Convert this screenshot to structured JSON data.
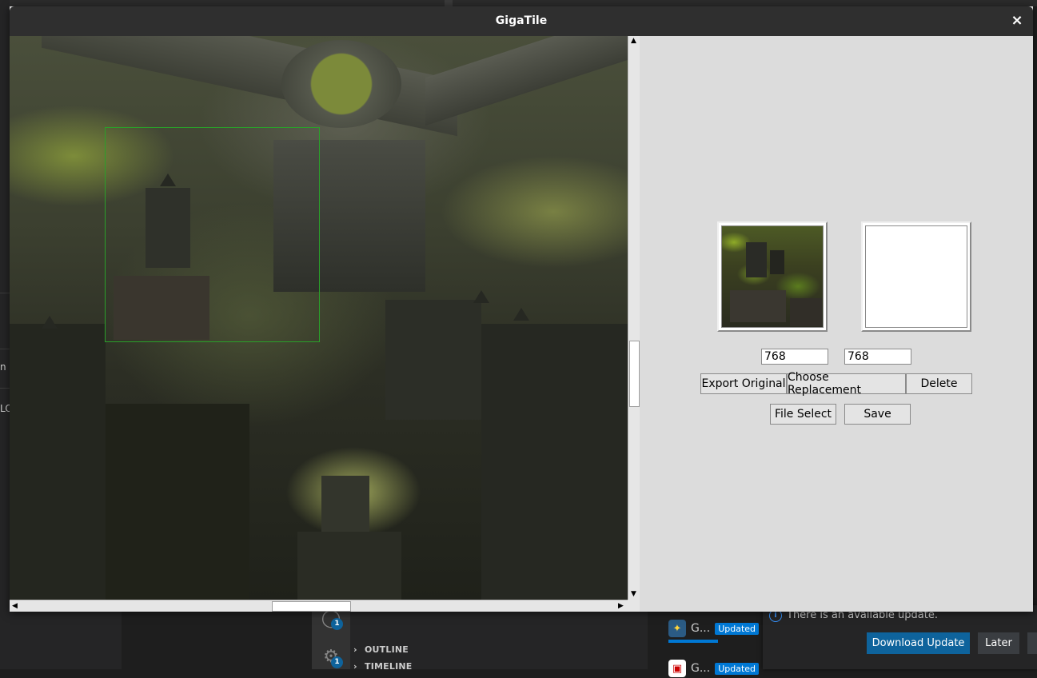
{
  "window": {
    "title": "GigaTile",
    "close_glyph": "×"
  },
  "panel": {
    "width_value": "768",
    "height_value": "768",
    "buttons": {
      "export_original": "Export Original",
      "choose_replacement": "Choose Replacement",
      "delete": "Delete",
      "file_select": "File Select",
      "save": "Save"
    }
  },
  "scrollbars": {
    "up_arrow": "▲",
    "down_arrow": "▼",
    "left_arrow": "◀",
    "right_arrow": "▶"
  },
  "background": {
    "left_fragments": [
      "n s",
      "LO"
    ],
    "sections": {
      "outline": "OUTLINE",
      "timeline": "TIMELINE",
      "chevron": "›"
    },
    "activity_badges": [
      "1",
      "1"
    ],
    "extensions": [
      {
        "icon": "python-icon",
        "name": "G...",
        "badge": "Updated"
      },
      {
        "icon": "extension-icon",
        "name": "G...",
        "badge": "Updated"
      }
    ],
    "notification": {
      "info_glyph": "i",
      "text": "There is an available update.",
      "download_label": "Download Update",
      "later_label": "Later"
    },
    "colors": {
      "accent": "#0e639c",
      "badge_blue": "#0078d4",
      "selection_green": "#2aa02a"
    }
  }
}
